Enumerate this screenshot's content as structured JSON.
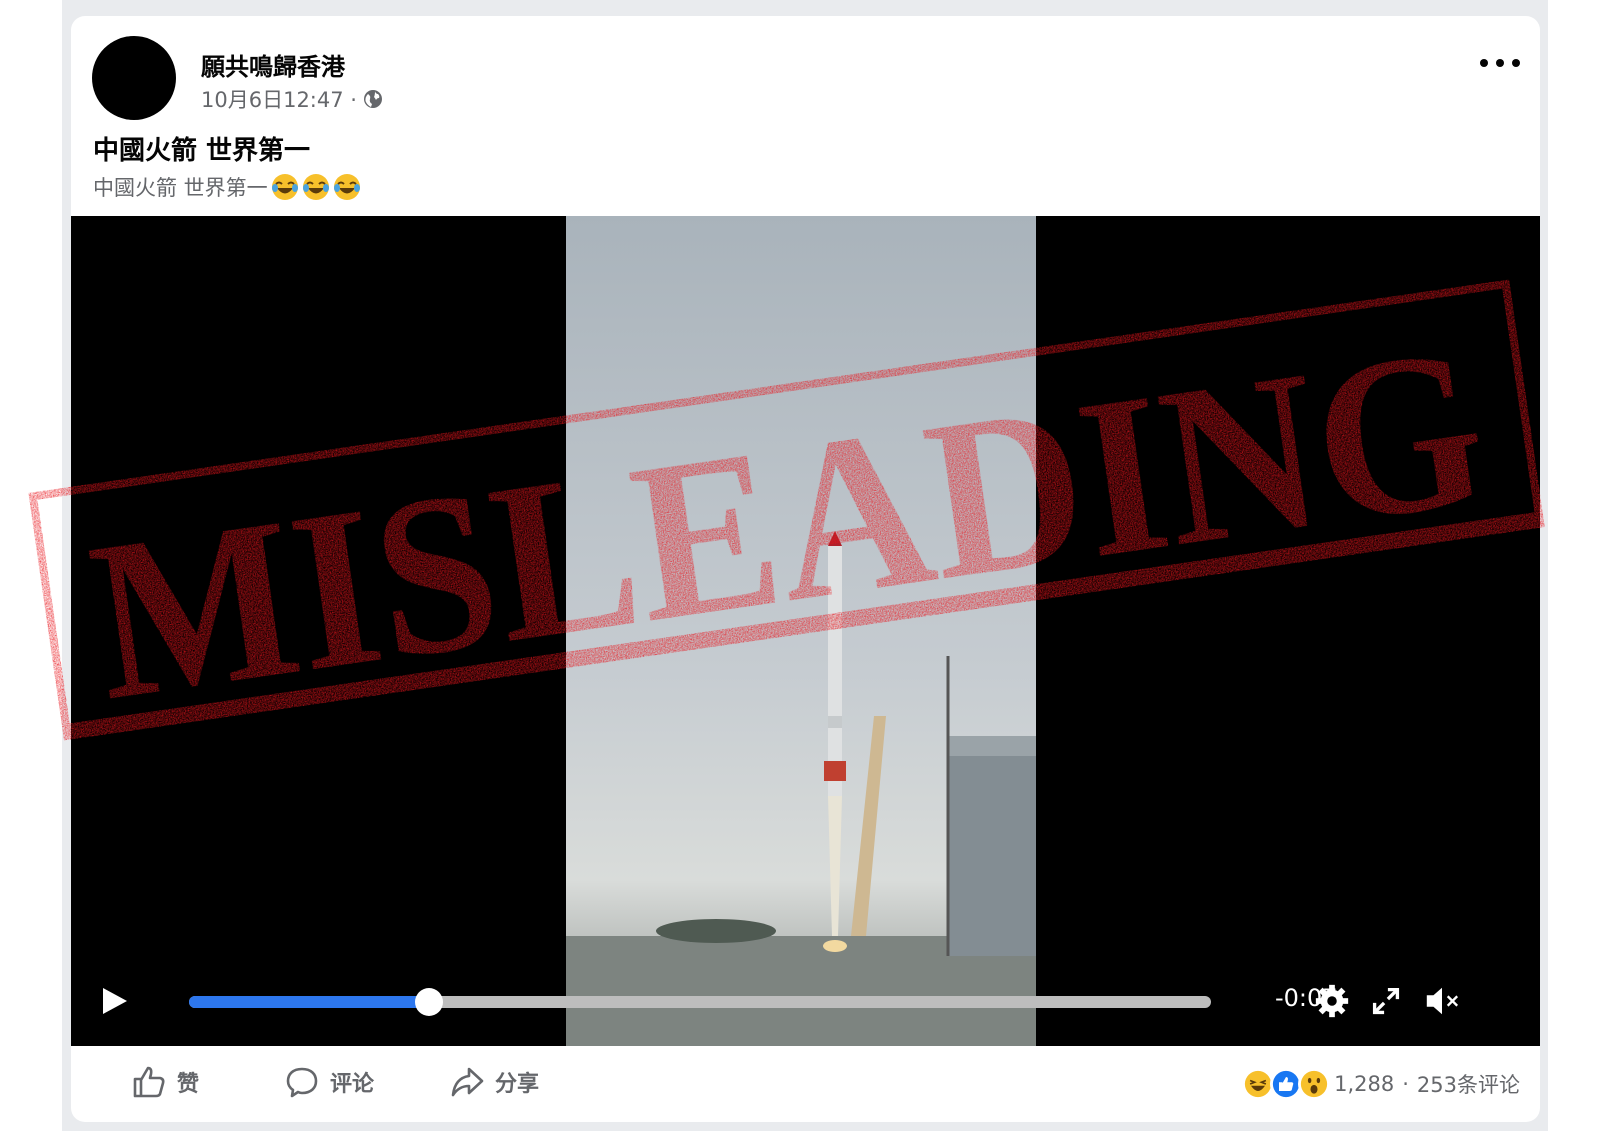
{
  "post": {
    "page_name": "願共鳴歸香港",
    "timestamp": "10月6日12:47 ·",
    "title": "中國火箭 世界第一",
    "text": "中國火箭 世界第一"
  },
  "video": {
    "progress": 0.235,
    "time_remaining": "-0:07"
  },
  "stamp": {
    "text": "MISLEADING",
    "color": "#e8141c"
  },
  "actions": {
    "like_label": "赞",
    "comment_label": "评论",
    "share_label": "分享"
  },
  "reactions": {
    "count": "1,288",
    "separator": "·",
    "comments": "253条评论"
  },
  "icons": [
    "globe-icon",
    "more-icon",
    "laugh-emoji",
    "play-icon",
    "settings-icon",
    "fullscreen-icon",
    "muted-icon",
    "like-icon",
    "comment-icon",
    "share-icon"
  ],
  "colors": {
    "accent": "#2d77ee",
    "text_secondary": "#65676b",
    "stamp": "#e8141c"
  }
}
